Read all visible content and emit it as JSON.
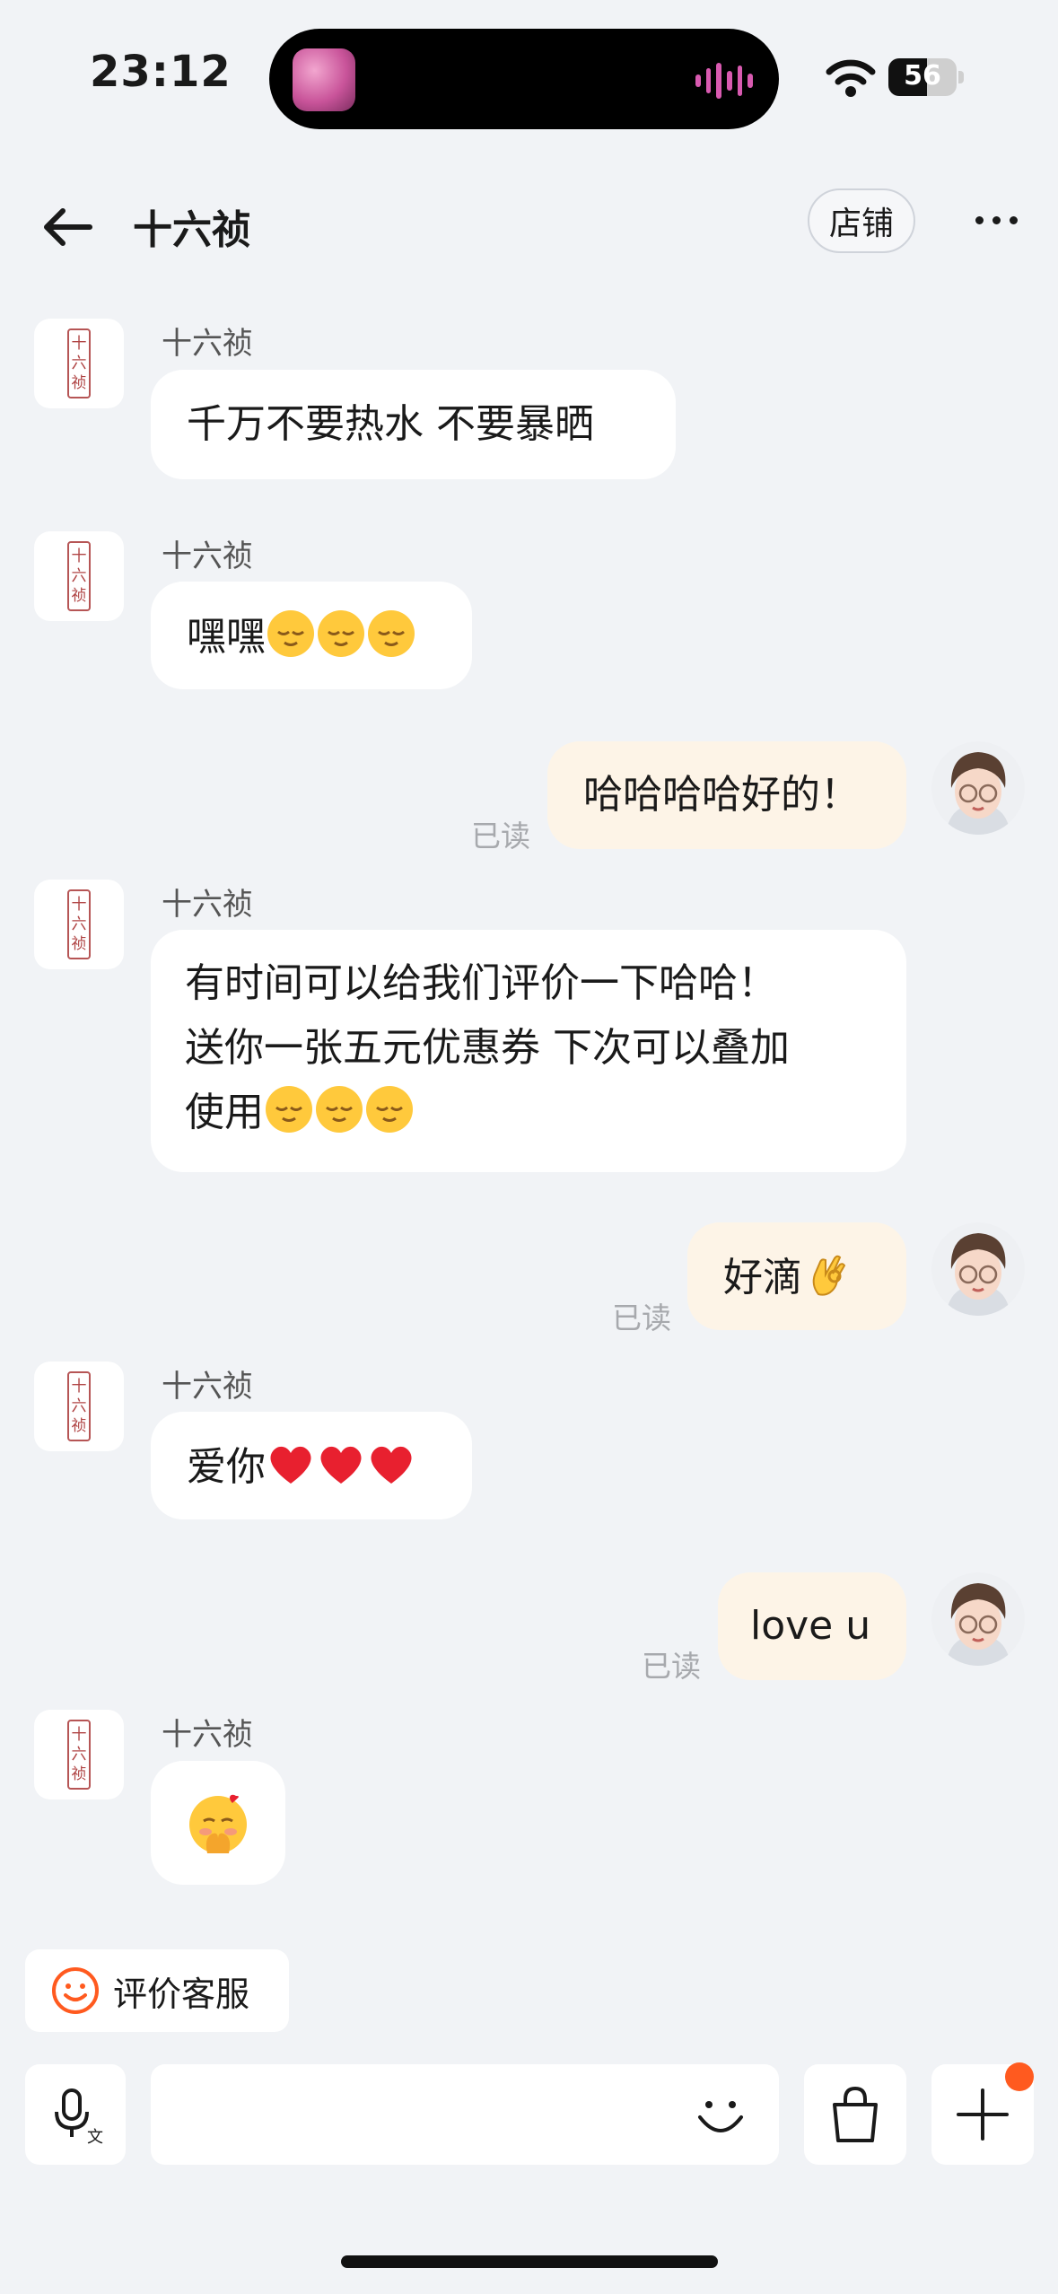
{
  "status_bar": {
    "time": "23:12",
    "battery": "56"
  },
  "header": {
    "title": "十六祯",
    "store_label": "店铺"
  },
  "messages": [
    {
      "sender": "十六祯",
      "text": "千万不要热水 不要暴晒"
    },
    {
      "sender": "十六祯",
      "text": "嘿嘿"
    },
    {
      "text": "哈哈哈哈好的！",
      "status": "已读"
    },
    {
      "sender": "十六祯",
      "lines": [
        "有时间可以给我们评价一下哈哈！",
        "送你一张五元优惠券 下次可以叠加",
        "使用"
      ]
    },
    {
      "text": "好滴",
      "status": "已读"
    },
    {
      "sender": "十六祯",
      "text": "爱你"
    },
    {
      "text": "love u",
      "status": "已读"
    },
    {
      "sender": "十六祯",
      "text": ""
    }
  ],
  "shop_seal_text": [
    "十",
    "六",
    "祯"
  ],
  "bottom": {
    "rate_service_label": "评价客服"
  },
  "colors": {
    "background": "#f1f3f6",
    "my_bubble": "#fdf4e7",
    "accent_orange": "#ff5a1f",
    "heart": "#e8202f"
  },
  "icons": [
    "back-arrow-icon",
    "more-icon",
    "wifi-icon",
    "smile-icon",
    "voice-icon",
    "emoji-icon",
    "shopping-bag-icon",
    "plus-icon"
  ]
}
